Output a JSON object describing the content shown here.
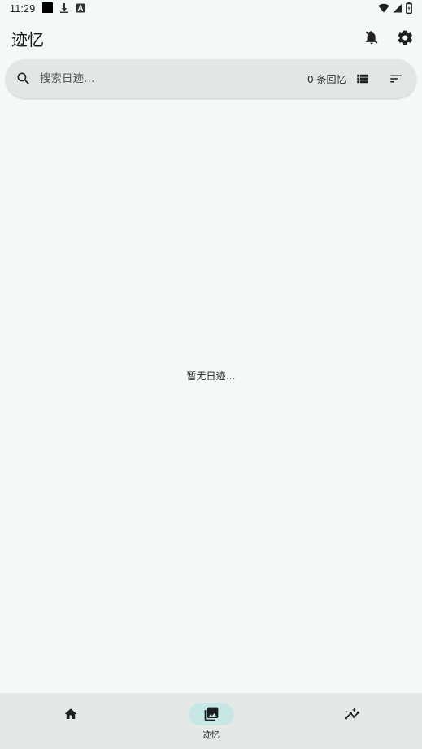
{
  "status_bar": {
    "time": "11:29",
    "left_icons": [
      "black-square-icon",
      "download-icon",
      "keyboard-a-icon"
    ],
    "right_icons": [
      "wifi-icon",
      "signal-icon",
      "battery-icon"
    ]
  },
  "app_bar": {
    "title": "迹忆",
    "actions": [
      "notifications-off-icon",
      "settings-icon"
    ]
  },
  "search": {
    "placeholder": "搜索日迹…",
    "count_label": "0 条回忆",
    "actions": [
      "view-list-icon",
      "sort-icon"
    ]
  },
  "main": {
    "empty_message": "暂无日迹…"
  },
  "bottom_nav": {
    "items": [
      {
        "icon": "home-icon",
        "label": "",
        "active": false
      },
      {
        "icon": "photo-library-icon",
        "label": "迹忆",
        "active": true
      },
      {
        "icon": "insights-icon",
        "label": "",
        "active": false
      }
    ]
  },
  "colors": {
    "background": "#f4f9f7",
    "search_bar": "#e2e7e6",
    "bottom_nav": "#e4e9e8",
    "active_indicator": "#c6e7e4"
  }
}
